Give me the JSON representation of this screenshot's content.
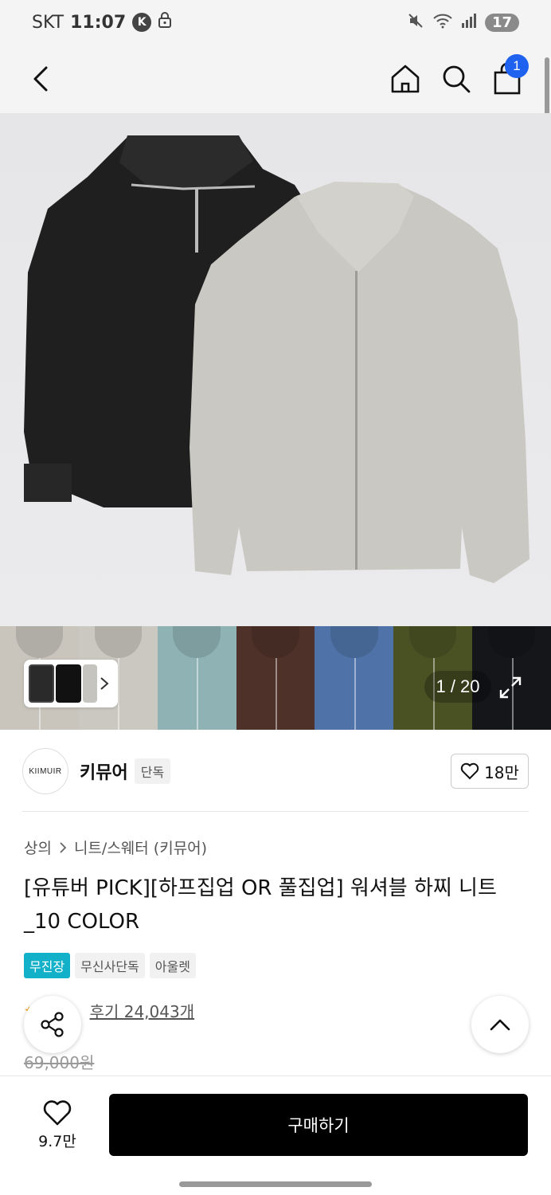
{
  "status_bar": {
    "carrier": "SKT",
    "time": "11:07",
    "k_icon": "K",
    "battery": "17"
  },
  "header": {
    "cart_count": "1"
  },
  "hero": {
    "page_counter": "1 / 20",
    "sweater_colors": {
      "left": "#1f1f1f",
      "right": "#c9c8c3",
      "swatches": [
        "#c9c5bd",
        "#cbc8c1",
        "#8fb3b5",
        "#4e3128",
        "#4f73a8",
        "#4a5224",
        "#15161a"
      ]
    }
  },
  "brand": {
    "logo_text": "KIIMUIR",
    "name": "키뮤어",
    "tag": "단독",
    "likes": "18만"
  },
  "product": {
    "breadcrumb": [
      "상의",
      "니트/스웨터 (키뮤어)"
    ],
    "title": "[유튜버 PICK][하프집업 OR 풀집업] 워셔블 하찌 니트_10 COLOR",
    "tags": [
      "무진장",
      "무신사단독",
      "아울렛"
    ],
    "reviews": "후기 24,043개",
    "original_price": "69,000원"
  },
  "bottom_bar": {
    "wish_count": "9.7만",
    "buy_label": "구매하기"
  },
  "colors": {
    "accent_blue": "#1f62f0",
    "tag_teal": "#12b0c9",
    "buy_black": "#000000"
  }
}
